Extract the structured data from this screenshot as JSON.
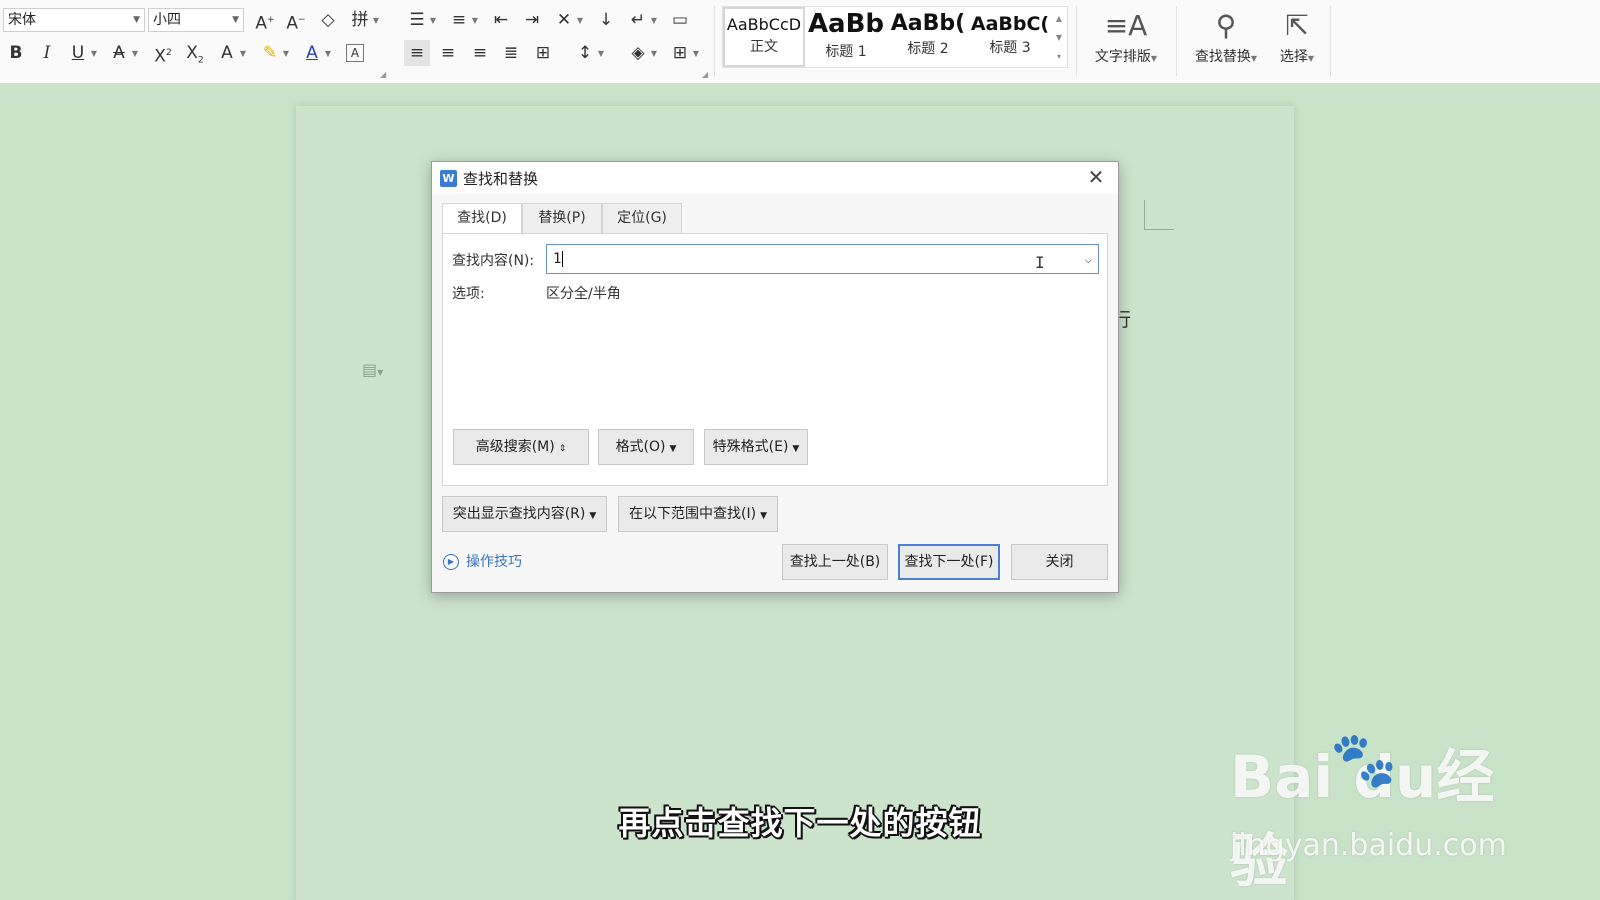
{
  "ribbon": {
    "font_name": "宋体",
    "font_size": "小四",
    "styles": [
      {
        "sample": "AaBbCcD",
        "name": "正文"
      },
      {
        "sample": "AaBb",
        "name": "标题 1"
      },
      {
        "sample": "AaBb(",
        "name": "标题 2"
      },
      {
        "sample": "AaBbC(",
        "name": "标题 3"
      }
    ],
    "text_layout_label": "文字排版",
    "find_replace_label": "查找替换",
    "select_label": "选择"
  },
  "document": {
    "partial_text": "行"
  },
  "dialog": {
    "title": "查找和替换",
    "tabs": [
      {
        "label": "查找(D)",
        "active": true
      },
      {
        "label": "替换(P)",
        "active": false
      },
      {
        "label": "定位(G)",
        "active": false
      }
    ],
    "find_label": "查找内容(N):",
    "find_value": "1",
    "options_label": "选项:",
    "options_value": "区分全/半角",
    "advanced_search": "高级搜索(M)",
    "format": "格式(O)",
    "special_format": "特殊格式(E)",
    "highlight": "突出显示查找内容(R)",
    "find_in": "在以下范围中查找(I)",
    "tips": "操作技巧",
    "find_prev": "查找上一处(B)",
    "find_next": "查找下一处(F)",
    "close": "关闭"
  },
  "subtitle": "再点击查找下一处的按钮",
  "watermark": {
    "logo": "Bai  du经验",
    "url": "jingyan.baidu.com"
  }
}
